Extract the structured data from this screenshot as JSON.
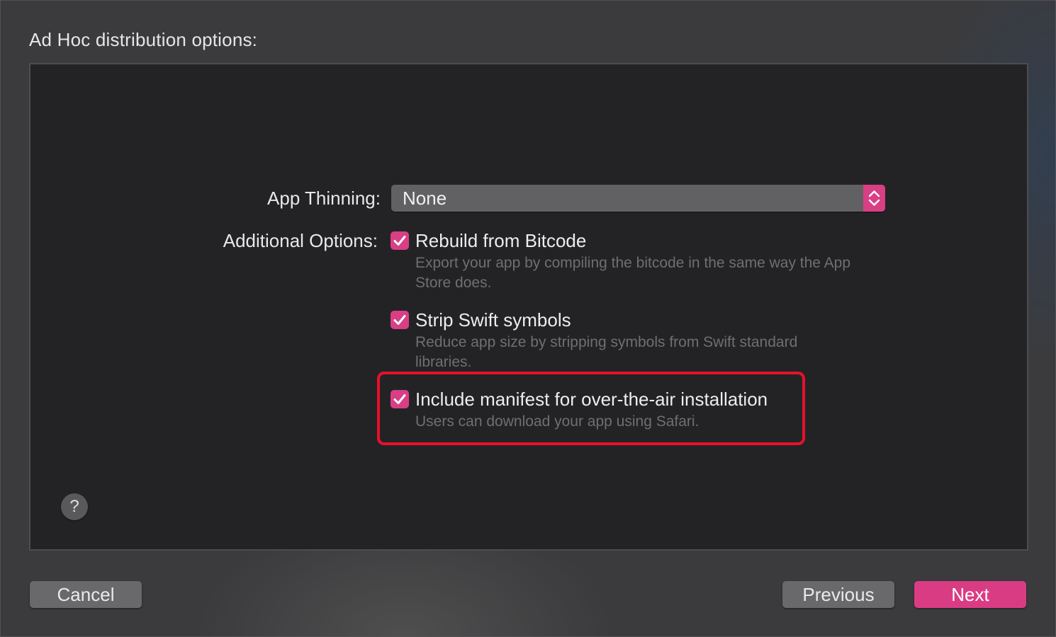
{
  "dialog": {
    "heading": "Ad Hoc distribution options:"
  },
  "app_thinning": {
    "label": "App Thinning:",
    "selected_value": "None",
    "stepper_icon": "chevron-up-down-icon"
  },
  "additional_options": {
    "label": "Additional Options:",
    "options": [
      {
        "title": "Rebuild from Bitcode",
        "description": "Export your app by compiling the bitcode in the same way the App Store does.",
        "checked": true
      },
      {
        "title": "Strip Swift symbols",
        "description": "Reduce app size by stripping symbols from Swift standard libraries.",
        "checked": true
      },
      {
        "title": "Include manifest for over-the-air installation",
        "description": "Users can download your app using Safari.",
        "checked": true
      }
    ]
  },
  "annotation": {
    "highlight_color": "#e8102a"
  },
  "help": {
    "glyph": "?"
  },
  "footer": {
    "cancel_label": "Cancel",
    "previous_label": "Previous",
    "next_label": "Next"
  },
  "colors": {
    "accent": "#d83f85",
    "panel_bg": "#232326",
    "window_bg": "#3b3b3d"
  }
}
